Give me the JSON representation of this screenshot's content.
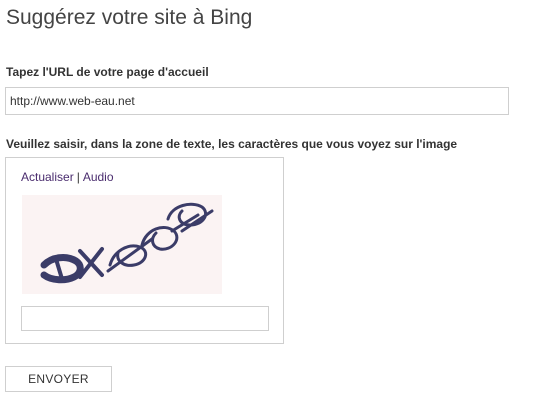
{
  "page": {
    "title": "Suggérez votre site à Bing"
  },
  "url_field": {
    "label": "Tapez l'URL de votre page d'accueil",
    "value": "http://www.web-eau.net"
  },
  "captcha": {
    "label": "Veuillez saisir, dans la zone de texte, les caractères que vous voyez sur l'image",
    "refresh_link": "Actualiser",
    "separator": "|",
    "audio_link": "Audio",
    "image_text": "jxpdp",
    "image_background": "#fbf3f3",
    "glyph_color": "#3b3c68",
    "input_value": ""
  },
  "submit": {
    "label": "ENVOYER"
  }
}
